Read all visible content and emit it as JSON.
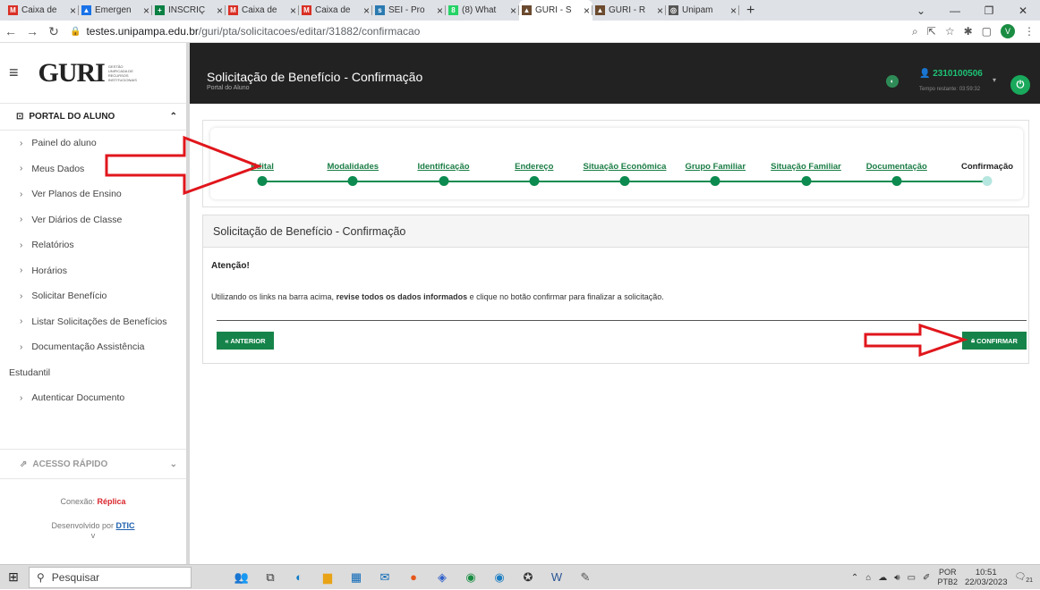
{
  "browser": {
    "tabs": [
      {
        "label": "Caixa de",
        "icon": "gmail-icon",
        "color": "#d93025",
        "glyph": "M",
        "active": false
      },
      {
        "label": "Emergen",
        "icon": "drive-icon",
        "color": "#1a73e8",
        "glyph": "▲",
        "active": false
      },
      {
        "label": "INSCRIÇ",
        "icon": "plus-icon",
        "color": "#0b8043",
        "glyph": "+",
        "active": false
      },
      {
        "label": "Caixa de",
        "icon": "gmail-icon",
        "color": "#d93025",
        "glyph": "M",
        "active": false
      },
      {
        "label": "Caixa de",
        "icon": "gmail-icon",
        "color": "#d93025",
        "glyph": "M",
        "active": false
      },
      {
        "label": "SEI - Pro",
        "icon": "sei-icon",
        "color": "#2a7ab0",
        "glyph": "s",
        "active": false
      },
      {
        "label": "(8) What",
        "icon": "whatsapp-icon",
        "color": "#25d366",
        "glyph": "8",
        "active": false
      },
      {
        "label": "GURI - S",
        "icon": "hat-icon",
        "color": "#6b4a2e",
        "glyph": "▲",
        "active": true
      },
      {
        "label": "GURI - R",
        "icon": "hat-icon",
        "color": "#6b4a2e",
        "glyph": "▲",
        "active": false
      },
      {
        "label": "Unipam",
        "icon": "globe-icon",
        "color": "#555555",
        "glyph": "◎",
        "active": false
      }
    ],
    "new_tab": "+",
    "url_host": "testes.unipampa.edu.br",
    "url_path": "/guri/pta/solicitacoes/editar/31882/confirmacao",
    "profile_initial": "V"
  },
  "sidebar": {
    "logo": "GURI",
    "logo_sub": "GESTÃO UNIFICADA DE RECURSOS INSTITUCIONAIS",
    "section": "PORTAL DO ALUNO",
    "items": [
      {
        "label": "Painel do aluno"
      },
      {
        "label": "Meus Dados"
      },
      {
        "label": "Ver Planos de Ensino"
      },
      {
        "label": "Ver Diários de Classe"
      },
      {
        "label": "Relatórios"
      },
      {
        "label": "Horários"
      },
      {
        "label": "Solicitar Benefício"
      },
      {
        "label": "Listar Solicitações de Benefícios"
      },
      {
        "label": "Documentação Assistência"
      }
    ],
    "item_wrap": "Estudantil",
    "item_last": "Autenticar Documento",
    "acesso_rapido": "ACESSO RÁPIDO",
    "conexao_label": "Conexão:",
    "conexao_value": "Réplica",
    "dev_label": "Desenvolvido por",
    "dev_link": "DTIC",
    "version": "v"
  },
  "topbar": {
    "title": "Solicitação de Benefício - Confirmação",
    "subtitle": "Portal do Aluno",
    "user_id": "2310100506",
    "time_left": "Tempo restante: 03:59:32"
  },
  "stepper": {
    "steps": [
      {
        "label": "Edital",
        "current": false
      },
      {
        "label": "Modalidades",
        "current": false
      },
      {
        "label": "Identificação",
        "current": false
      },
      {
        "label": "Endereço",
        "current": false
      },
      {
        "label": "Situação Econômica",
        "current": false
      },
      {
        "label": "Grupo Familiar",
        "current": false
      },
      {
        "label": "Situação Familiar",
        "current": false
      },
      {
        "label": "Documentação",
        "current": false
      },
      {
        "label": "Confirmação",
        "current": true
      }
    ]
  },
  "panel": {
    "title": "Solicitação de Benefício - Confirmação",
    "warning": "Atenção!",
    "msg_before": "Utilizando os links na barra acima, ",
    "msg_bold": "revise todos os dados informados",
    "msg_after": " e clique no botão confirmar para finalizar a solicitação.",
    "back_button": "« ANTERIOR",
    "confirm_button": "CONFIRMAR"
  },
  "taskbar": {
    "search_placeholder": "Pesquisar",
    "lang1": "POR",
    "lang2": "PTB2",
    "time": "10:51",
    "date": "22/03/2023",
    "notif_count": "21"
  },
  "colors": {
    "accent_green": "#16844a",
    "arrow_red": "#e0161c",
    "topbar_bg": "#222222"
  }
}
